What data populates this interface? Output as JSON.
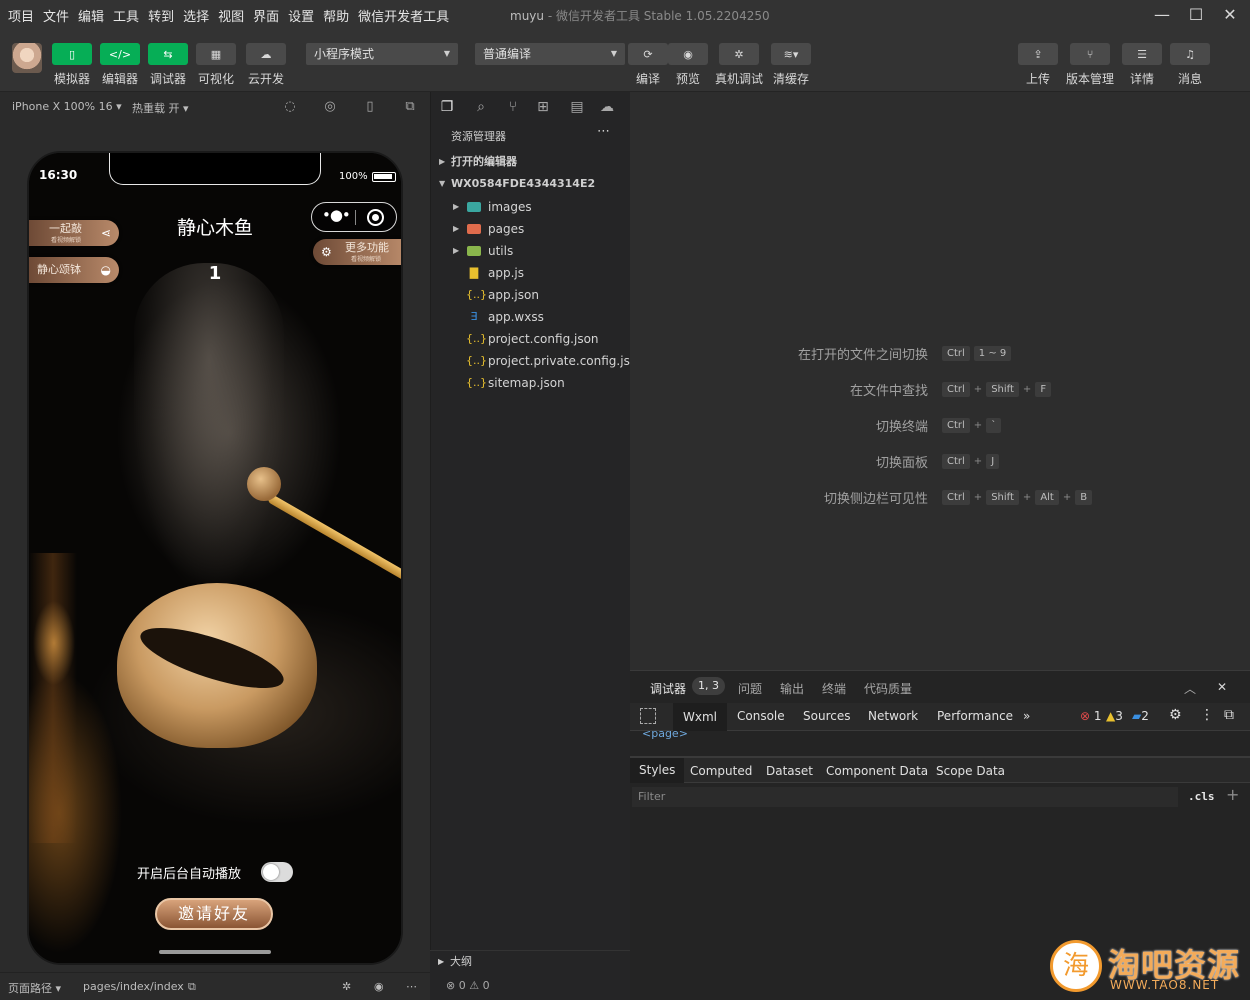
{
  "menubar": {
    "items": [
      "项目",
      "文件",
      "编辑",
      "工具",
      "转到",
      "选择",
      "视图",
      "界面",
      "设置",
      "帮助",
      "微信开发者工具"
    ],
    "project_name": "muyu",
    "app_version": "- 微信开发者工具 Stable 1.05.2204250"
  },
  "toolbar": {
    "simulator_label": "模拟器",
    "editor_label": "编辑器",
    "debugger_label": "调试器",
    "visual_label": "可视化",
    "cloud_label": "云开发",
    "mode_select": "小程序模式",
    "compile_select": "普通编译",
    "compile_label": "编译",
    "preview_label": "预览",
    "real_debug_label": "真机调试",
    "clear_cache_label": "清缓存",
    "upload_label": "上传",
    "version_label": "版本管理",
    "details_label": "详情",
    "messages_label": "消息"
  },
  "simbar": {
    "device": "iPhone X 100% 16 ▾",
    "hot_reload": "热重载 开 ▾"
  },
  "phone": {
    "time": "16:30",
    "battery": "100%",
    "title": "静心木鱼",
    "count": "1",
    "pill_together": "一起敲",
    "pill_together_sub": "看视频解锁",
    "pill_song": "静心颂钵",
    "pill_more": "更多功能",
    "pill_more_sub": "看视频解锁",
    "autoplay_label": "开启后台自动播放",
    "invite_label": "邀请好友"
  },
  "simfoot": {
    "path_label": "页面路径 ▾",
    "path": "pages/index/index"
  },
  "explorer": {
    "title": "资源管理器",
    "open_editors": "打开的编辑器",
    "project_root": "WX0584FDE4344314E2",
    "files": [
      {
        "name": "images"
      },
      {
        "name": "pages"
      },
      {
        "name": "utils"
      },
      {
        "name": "app.js"
      },
      {
        "name": "app.json"
      },
      {
        "name": "app.wxss"
      },
      {
        "name": "project.config.json"
      },
      {
        "name": "project.private.config.js..."
      },
      {
        "name": "sitemap.json"
      }
    ],
    "outline": "大纲",
    "status_errors": "⊗ 0 ⚠ 0"
  },
  "editor": {
    "shortcuts": [
      {
        "label": "在打开的文件之间切换",
        "keys": [
          "Ctrl",
          "1 ~ 9"
        ]
      },
      {
        "label": "在文件中查找",
        "keys": [
          "Ctrl",
          "Shift",
          "F"
        ]
      },
      {
        "label": "切换终端",
        "keys": [
          "Ctrl",
          "`"
        ]
      },
      {
        "label": "切换面板",
        "keys": [
          "Ctrl",
          "J"
        ]
      },
      {
        "label": "切换侧边栏可见性",
        "keys": [
          "Ctrl",
          "Shift",
          "Alt",
          "B"
        ]
      }
    ]
  },
  "devtools": {
    "tabs": [
      "调试器",
      "问题",
      "输出",
      "终端",
      "代码质量"
    ],
    "badge": "1, 3",
    "subtabs": [
      "Wxml",
      "Console",
      "Sources",
      "Network",
      "Performance"
    ],
    "more": "»",
    "errors": "1",
    "warnings": "3",
    "infos": "2",
    "dom_fragment": "<page>",
    "styles_tabs": [
      "Styles",
      "Computed",
      "Dataset",
      "Component Data",
      "Scope Data"
    ],
    "filter_placeholder": "Filter",
    "cls": ".cls",
    "plus": "+"
  },
  "watermark": {
    "mark": "海",
    "text": "淘吧资源",
    "url": "WWW.TAO8.NET"
  },
  "colors": {
    "accent_green": "#06ae56",
    "background": "#2b2b2b",
    "watermark_orange": "#f29a2e"
  }
}
